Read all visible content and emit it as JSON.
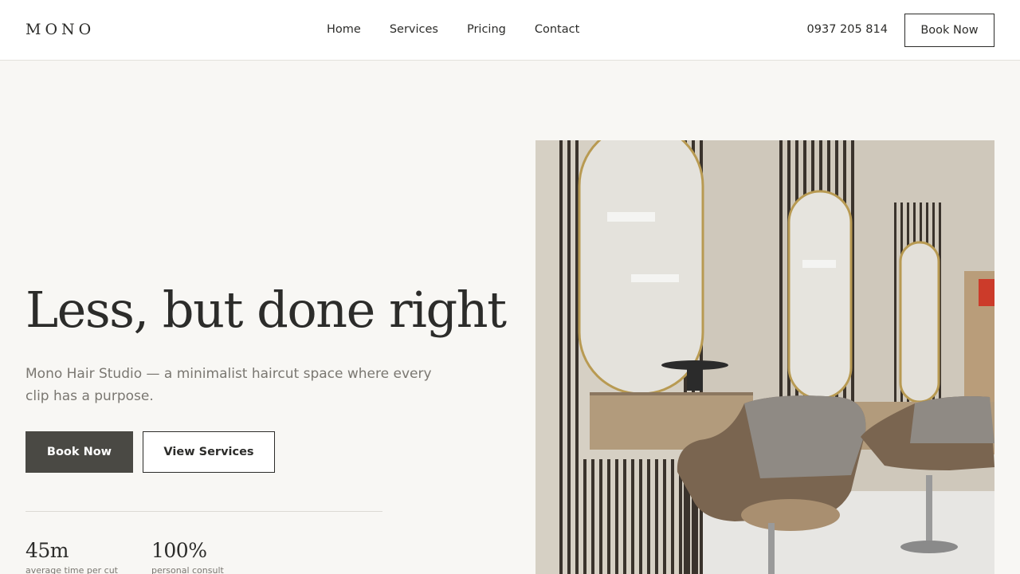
{
  "header": {
    "logo": "MONO",
    "nav": [
      "Home",
      "Services",
      "Pricing",
      "Contact"
    ],
    "phone": "0937 205 814",
    "book_label": "Book Now"
  },
  "hero": {
    "title": "Less, but done right",
    "subtitle": "Mono Hair Studio — a minimalist haircut space where every clip has a purpose.",
    "primary_button": "Book Now",
    "secondary_button": "View Services",
    "stats": [
      {
        "value": "45m",
        "label": "average time per cut"
      },
      {
        "value": "100%",
        "label": "personal consult"
      }
    ],
    "image_alt": "salon-interior-photo"
  },
  "colors": {
    "background": "#f8f7f4",
    "text": "#2c2c2a",
    "muted": "#7a7771",
    "primary_button": "#4a4944"
  }
}
